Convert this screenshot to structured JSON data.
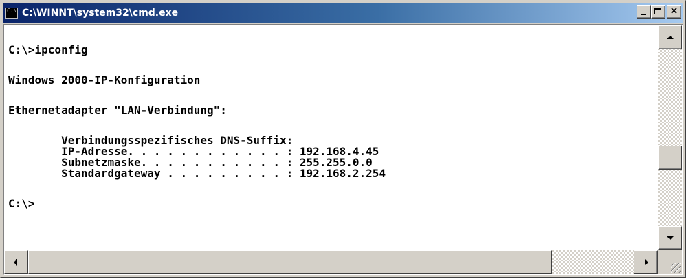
{
  "window": {
    "title": "C:\\WINNT\\system32\\cmd.exe",
    "icon": "console-app-icon",
    "icon_glyph": "C:\\",
    "buttons": {
      "minimize": "minimize-icon",
      "maximize": "maximize-icon",
      "close": "close-icon",
      "close_glyph": "×"
    }
  },
  "console": {
    "lines": [
      "C:\\>ipconfig",
      "Windows 2000-IP-Konfiguration",
      "Ethernetadapter \"LAN-Verbindung\":",
      "        Verbindungsspezifisches DNS-Suffix:",
      "        IP-Adresse. . . . . . . . . . . . : 192.168.4.45",
      "        Subnetzmaske. . . . . . . . . . . : 255.255.0.0",
      "        Standardgateway . . . . . . . . . : 192.168.2.254",
      "C:\\>"
    ]
  },
  "colors": {
    "console_background": "#ffffff",
    "console_text": "#000000",
    "titlebar_start": "#0a246a",
    "titlebar_end": "#a6caf0",
    "chrome": "#d4d0c8"
  }
}
